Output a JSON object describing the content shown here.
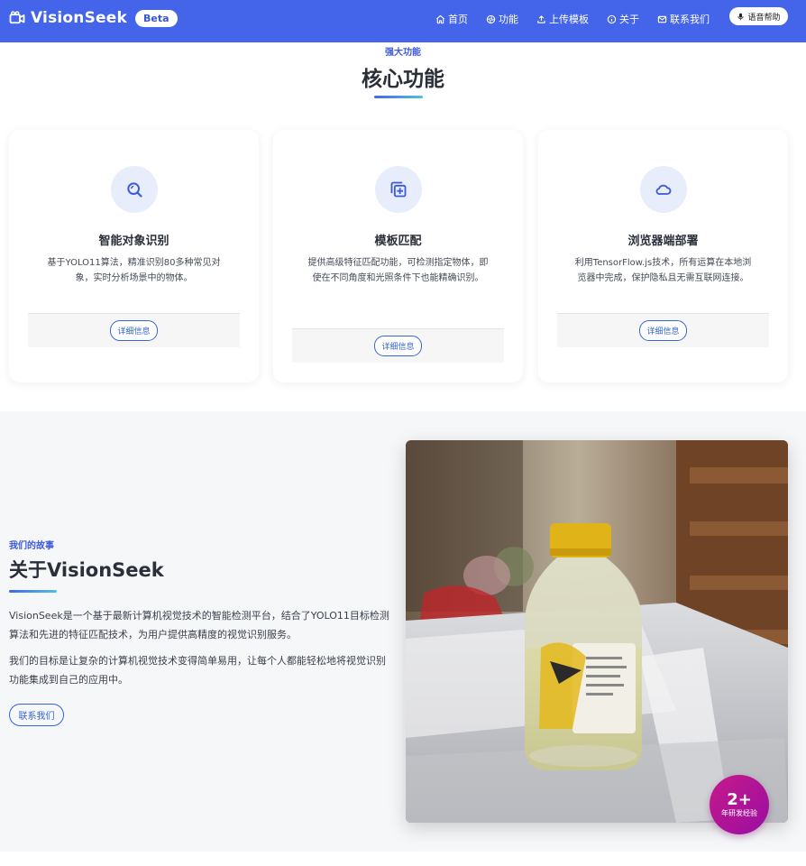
{
  "nav": {
    "brand": "VisionSeek",
    "badge": "Beta",
    "links": [
      {
        "label": "首页",
        "icon": "home-icon"
      },
      {
        "label": "功能",
        "icon": "aperture-icon"
      },
      {
        "label": "上传模板",
        "icon": "upload-icon"
      },
      {
        "label": "关于",
        "icon": "info-icon"
      },
      {
        "label": "联系我们",
        "icon": "mail-icon"
      }
    ],
    "voice_help": "语音帮助"
  },
  "features": {
    "eyebrow": "强大功能",
    "title": "核心功能",
    "cards": [
      {
        "title": "智能对象识别",
        "desc": "基于YOLO11算法，精准识别80多种常见对象，实时分析场景中的物体。",
        "button": "详细信息",
        "icon": "search-icon"
      },
      {
        "title": "模板匹配",
        "desc": "提供高级特征匹配功能，可检测指定物体，即使在不同角度和光照条件下也能精确识别。",
        "button": "详细信息",
        "icon": "template-icon"
      },
      {
        "title": "浏览器端部署",
        "desc": "利用TensorFlow.js技术，所有运算在本地浏览器中完成，保护隐私且无需互联网连接。",
        "button": "详细信息",
        "icon": "cloud-icon"
      }
    ]
  },
  "about": {
    "eyebrow": "我们的故事",
    "title": "关于VisionSeek",
    "paragraph1": "VisionSeek是一个基于最新计算机视觉技术的智能检测平台，结合了YOLO11目标检测算法和先进的特征匹配技术，为用户提供高精度的视觉识别服务。",
    "paragraph2": "我们的目标是让复杂的计算机视觉技术变得简单易用，让每个人都能轻松地将视觉识别功能集成到自己的应用中。",
    "contact_button": "联系我们",
    "badge_number": "2+",
    "badge_label": "年研发经验"
  },
  "colors": {
    "primary": "#4465ea",
    "accent_gradient_end": "#4ec3e0",
    "badge": "#b8148f"
  }
}
